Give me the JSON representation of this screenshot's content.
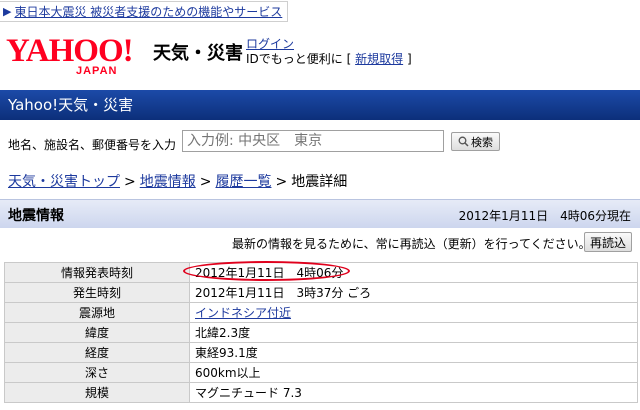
{
  "notice": {
    "text": "東日本大震災 被災者支援のための機能やサービス"
  },
  "header": {
    "logo_text": "YAHOO!",
    "logo_sub": "JAPAN",
    "service_name": "天気・災害",
    "login_label": "ログイン",
    "login_desc_prefix": "IDでもっと便利に [",
    "register_label": "新規取得",
    "login_desc_suffix": "]"
  },
  "titlebar": {
    "title": "Yahoo!天気・災害"
  },
  "search": {
    "label": "地名、施設名、郵便番号を入力",
    "placeholder": "入力例: 中央区　東京",
    "button_label": "検索"
  },
  "breadcrumb": {
    "items": [
      "天気・災害トップ",
      "地震情報",
      "履歴一覧"
    ],
    "current": "地震詳細",
    "separator": ">"
  },
  "section": {
    "title": "地震情報",
    "timestamp": "2012年1月11日　4時06分現在"
  },
  "reload": {
    "message": "最新の情報を見るために、常に再読込（更新）を行ってください。",
    "button_label": "再読込"
  },
  "table": {
    "rows": [
      {
        "label": "情報発表時刻",
        "value": "2012年1月11日　4時06分"
      },
      {
        "label": "発生時刻",
        "value": "2012年1月11日　3時37分 ごろ"
      },
      {
        "label": "震源地",
        "value": "インドネシア付近"
      },
      {
        "label": "緯度",
        "value": "北緯2.3度"
      },
      {
        "label": "経度",
        "value": "東経93.1度"
      },
      {
        "label": "深さ",
        "value": "600km以上"
      },
      {
        "label": "規模",
        "value": "マグニチュード 7.3"
      }
    ]
  },
  "colors": {
    "brand_red": "#ff0020",
    "titlebar_blue": "#1c4aa8",
    "link_blue": "#1d3a9e",
    "highlight_red": "#e0001c"
  }
}
